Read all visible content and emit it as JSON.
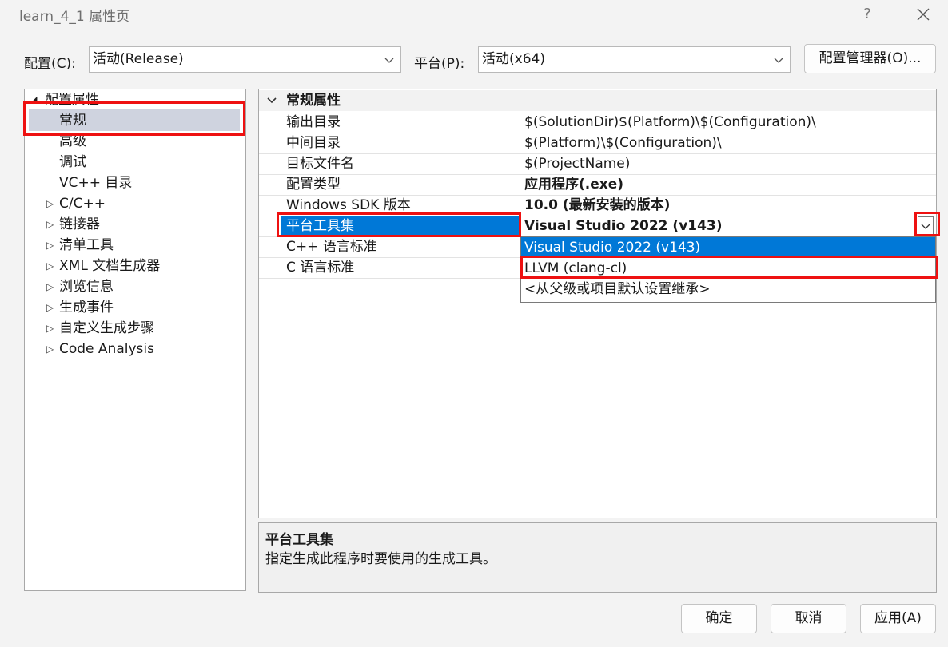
{
  "window": {
    "title": "learn_4_1 属性页",
    "help": "?"
  },
  "toolbar": {
    "config_label": "配置(C):",
    "config_value": "活动(Release)",
    "platform_label": "平台(P):",
    "platform_value": "活动(x64)",
    "config_manager": "配置管理器(O)..."
  },
  "tree": {
    "root": "配置属性",
    "items": [
      {
        "label": "常规",
        "selected": true
      },
      {
        "label": "高级"
      },
      {
        "label": "调试"
      },
      {
        "label": "VC++ 目录"
      },
      {
        "label": "C/C++",
        "expandable": true
      },
      {
        "label": "链接器",
        "expandable": true
      },
      {
        "label": "清单工具",
        "expandable": true
      },
      {
        "label": "XML 文档生成器",
        "expandable": true
      },
      {
        "label": "浏览信息",
        "expandable": true
      },
      {
        "label": "生成事件",
        "expandable": true
      },
      {
        "label": "自定义生成步骤",
        "expandable": true
      },
      {
        "label": "Code Analysis",
        "expandable": true
      }
    ]
  },
  "grid": {
    "section": "常规属性",
    "rows": [
      {
        "name": "输出目录",
        "value": "$(SolutionDir)$(Platform)\\$(Configuration)\\"
      },
      {
        "name": "中间目录",
        "value": "$(Platform)\\$(Configuration)\\"
      },
      {
        "name": "目标文件名",
        "value": "$(ProjectName)"
      },
      {
        "name": "配置类型",
        "value": "应用程序(.exe)"
      },
      {
        "name": "Windows SDK 版本",
        "value": "10.0 (最新安装的版本)"
      },
      {
        "name": "平台工具集",
        "value": "Visual Studio 2022 (v143)"
      },
      {
        "name": "C++ 语言标准",
        "value": ""
      },
      {
        "name": "C 语言标准",
        "value": ""
      }
    ]
  },
  "dropdown": {
    "options": [
      "Visual Studio 2022 (v143)",
      "LLVM (clang-cl)",
      "<从父级或项目默认设置继承>"
    ]
  },
  "description": {
    "title": "平台工具集",
    "text": "指定生成此程序时要使用的生成工具。"
  },
  "buttons": {
    "ok": "确定",
    "cancel": "取消",
    "apply": "应用(A)"
  },
  "colors": {
    "selection": "#0078d7",
    "annotation": "#ee1111"
  }
}
